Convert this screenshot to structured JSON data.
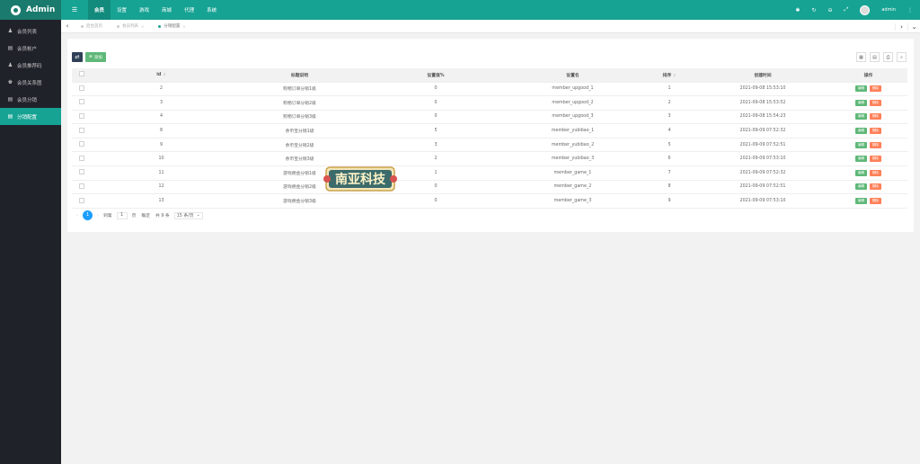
{
  "app": {
    "title": "Admin"
  },
  "sidebar": {
    "items": [
      {
        "icon": "user-icon",
        "label": "会员列表",
        "active": false
      },
      {
        "icon": "card-icon",
        "label": "会员帐户",
        "active": false
      },
      {
        "icon": "users-icon",
        "label": "会员推荐码",
        "active": false
      },
      {
        "icon": "group-icon",
        "label": "会员关系图",
        "active": false
      },
      {
        "icon": "list-icon",
        "label": "会员分销",
        "active": false
      },
      {
        "icon": "config-icon",
        "label": "分销配置",
        "active": true
      }
    ]
  },
  "topbar": {
    "tabs": [
      "会员",
      "设置",
      "游戏",
      "商城",
      "代理",
      "系统"
    ],
    "active_tab": "会员",
    "admin_name": "admin"
  },
  "tabnav": {
    "tabs": [
      {
        "label": "后台首页",
        "active": false
      },
      {
        "label": "会员列表",
        "active": false
      },
      {
        "label": "分销配置",
        "active": true
      }
    ]
  },
  "toolbar": {
    "add_label": "添加"
  },
  "table": {
    "columns": [
      "id",
      "标题说明",
      "设置值%",
      "设置名",
      "排序",
      "创建时间",
      "操作"
    ],
    "edit_label": "编辑",
    "delete_label": "删除",
    "rows": [
      {
        "id": "2",
        "title": "购物订单分销1级",
        "value": "0",
        "name": "member_upgood_1",
        "sort": "1",
        "created": "2021-09-08 15:53:10"
      },
      {
        "id": "3",
        "title": "购物订单分销2级",
        "value": "0",
        "name": "member_upgood_2",
        "sort": "2",
        "created": "2021-09-08 15:53:52"
      },
      {
        "id": "4",
        "title": "购物订单分销3级",
        "value": "0",
        "name": "member_upgood_3",
        "sort": "3",
        "created": "2021-09-08 15:54:23"
      },
      {
        "id": "8",
        "title": "余币宝分销1级",
        "value": "5",
        "name": "member_yubibao_1",
        "sort": "4",
        "created": "2021-09-09 07:52:32"
      },
      {
        "id": "9",
        "title": "余币宝分销2级",
        "value": "3",
        "name": "member_yubibao_2",
        "sort": "5",
        "created": "2021-09-09 07:52:51"
      },
      {
        "id": "10",
        "title": "余币宝分销3级",
        "value": "2",
        "name": "member_yubibao_3",
        "sort": "6",
        "created": "2021-09-09 07:53:10"
      },
      {
        "id": "11",
        "title": "游戏佣金分销1级",
        "value": "1",
        "name": "member_game_1",
        "sort": "7",
        "created": "2021-09-09 07:52:32"
      },
      {
        "id": "12",
        "title": "游戏佣金分销2级",
        "value": "0",
        "name": "member_game_2",
        "sort": "8",
        "created": "2021-09-09 07:52:51"
      },
      {
        "id": "13",
        "title": "游戏佣金分销3级",
        "value": "0",
        "name": "member_game_3",
        "sort": "9",
        "created": "2021-09-09 07:53:10"
      }
    ]
  },
  "pagination": {
    "current": "1",
    "goto_label": "到第",
    "page_input": "1",
    "page_suffix": "页",
    "confirm_label": "确定",
    "total": "共 9 条",
    "per_page": "15 条/页"
  },
  "watermark": {
    "text": "南亚科技"
  },
  "colors": {
    "primary": "#16a393",
    "sidebar": "#20222a",
    "edit": "#5fb878",
    "delete": "#ff5722",
    "page_active": "#1e9fff"
  }
}
